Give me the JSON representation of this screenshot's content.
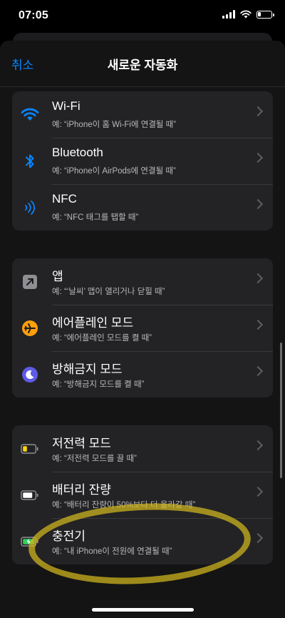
{
  "status": {
    "time": "07:05"
  },
  "nav": {
    "cancel_label": "취소",
    "title": "새로운 자동화"
  },
  "groups": [
    {
      "items": [
        {
          "title": "Wi-Fi",
          "subtitle": "예: “iPhone이 홈 Wi-Fi에 연결될 때”",
          "icon": "wifi-icon"
        },
        {
          "title": "Bluetooth",
          "subtitle": "예: “iPhone이 AirPods에 연결될 때”",
          "icon": "bluetooth-icon"
        },
        {
          "title": "NFC",
          "subtitle": "예: “NFC 태그를 탭할 때”",
          "icon": "nfc-icon"
        }
      ]
    },
    {
      "items": [
        {
          "title": "앱",
          "subtitle": "예: “‘날씨’ 앱이 열리거나 닫힐 때”",
          "icon": "app-arrow-icon"
        },
        {
          "title": "에어플레인 모드",
          "subtitle": "예: “에어플레인 모드를 켤 때”",
          "icon": "airplane-icon"
        },
        {
          "title": "방해금지 모드",
          "subtitle": "예: “방해금지 모드를 켤 때”",
          "icon": "moon-icon"
        }
      ]
    },
    {
      "items": [
        {
          "title": "저전력 모드",
          "subtitle": "예: “저전력 모드를 끌 때”",
          "icon": "low-power-battery-icon"
        },
        {
          "title": "배터리 잔량",
          "subtitle": "예: “배터리 잔량이 50%보다 더 올라갈 때”",
          "icon": "battery-level-icon"
        },
        {
          "title": "충전기",
          "subtitle": "예: “내 iPhone이 전원에 연결될 때”",
          "icon": "charger-icon"
        }
      ]
    }
  ],
  "colors": {
    "accent": "#0a84ff",
    "airplane": "#ff9f0a",
    "moon": "#5e5ce6",
    "low_power": "#ffd60a",
    "charging": "#30d158",
    "highlight": "#d2b81e"
  }
}
